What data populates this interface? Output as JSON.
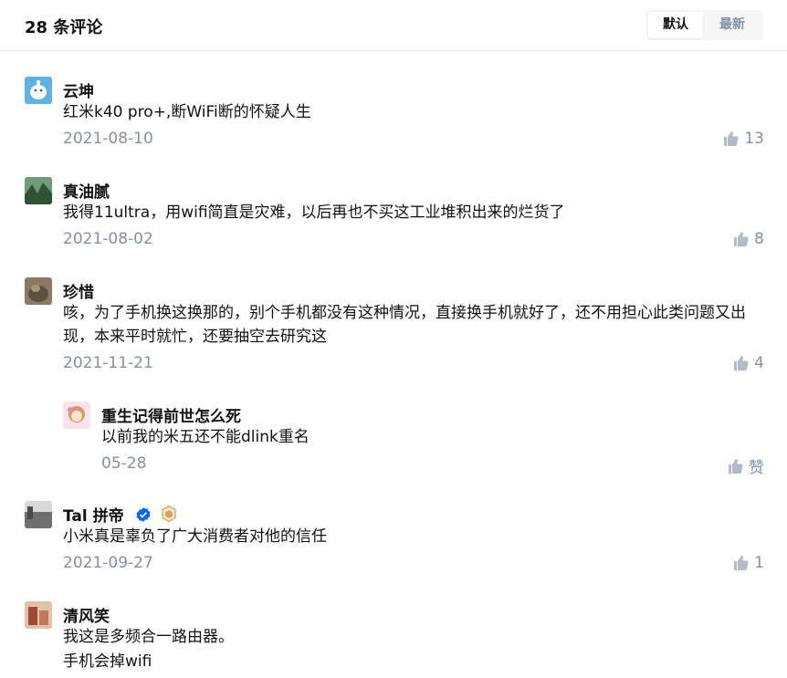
{
  "header": {
    "title": "28 条评论",
    "sort": {
      "default_label": "默认",
      "latest_label": "最新",
      "active": "default"
    }
  },
  "comments": [
    {
      "author": "云坤",
      "content": "红米k40 pro+,断WiFi断的怀疑人生",
      "date": "2021-08-10",
      "likes": "13",
      "avatar_colors": [
        "#6ab6e8",
        "#ffffff"
      ]
    },
    {
      "author": "真油腻",
      "content": "我得11ultra，用wifi简直是灾难，以后再也不买这工业堆积出来的烂货了",
      "date": "2021-08-02",
      "likes": "8",
      "avatar_colors": [
        "#3c6a44",
        "#9ec3a0"
      ]
    },
    {
      "author": "珍惜",
      "content": "咳，为了手机换这换那的，别个手机都没有这种情况，直接换手机就好了，还不用担心此类问题又出现，本来平时就忙，还要抽空去研究这",
      "date": "2021-11-21",
      "likes": "4",
      "avatar_colors": [
        "#5d5040",
        "#a89478"
      ],
      "replies": [
        {
          "author": "重生记得前世怎么死",
          "content": "以前我的米五还不能dlink重名",
          "date": "05-28",
          "likes": "赞",
          "avatar_colors": [
            "#f3c7d8",
            "#d69a6a"
          ]
        }
      ]
    },
    {
      "author": "Tal 拼帝",
      "content": "小米真是辜负了广大消费者对他的信任",
      "date": "2021-09-27",
      "likes": "1",
      "avatar_colors": [
        "#777777",
        "#c9c9c9"
      ],
      "verified_color": "#0066ff",
      "level_badge_color": "#d9a45b"
    },
    {
      "author": "清风笑",
      "content_lines": [
        "我这是多频合一路由器。",
        "手机会掉wifi"
      ],
      "avatar_colors": [
        "#a0483c",
        "#e1c4a5"
      ]
    }
  ]
}
